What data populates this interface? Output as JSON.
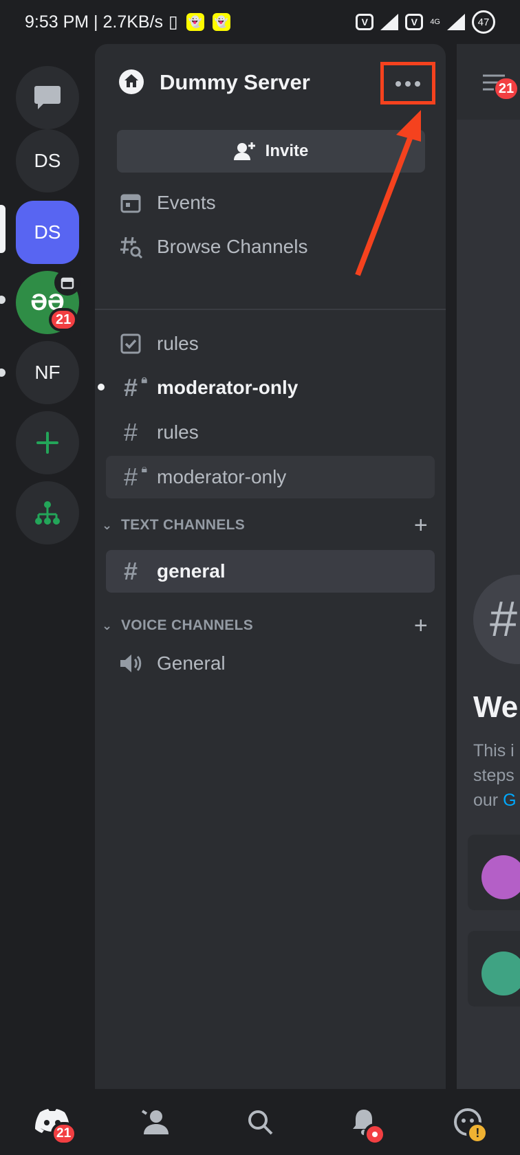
{
  "status_bar": {
    "time_speed": "9:53 PM | 2.7KB/s",
    "vibrate_glyph": "▯",
    "snap_glyph": "👻",
    "sim1": "V",
    "sim2": "V",
    "network": "4G",
    "battery": "47"
  },
  "guilds": [
    {
      "label": "DS"
    },
    {
      "label": "DS"
    },
    {
      "label": "ƏƏ",
      "badge": "21"
    },
    {
      "label": "NF"
    }
  ],
  "server": {
    "name": "Dummy Server",
    "invite_label": "Invite"
  },
  "menu_items": [
    {
      "label": "Events"
    },
    {
      "label": "Browse Channels"
    }
  ],
  "channels_top": [
    {
      "name": "rules"
    },
    {
      "name": "moderator-only"
    },
    {
      "name": "rules"
    },
    {
      "name": "moderator-only"
    }
  ],
  "text_category": {
    "label": "TEXT CHANNELS",
    "channels": [
      {
        "name": "general"
      }
    ]
  },
  "voice_category": {
    "label": "VOICE CHANNELS",
    "channels": [
      {
        "name": "General"
      }
    ]
  },
  "peek": {
    "badge": "21",
    "heading": "We",
    "line1": "This i",
    "line2": "steps",
    "line3_prefix": "our ",
    "line3_link": "G"
  },
  "bottom_nav": {
    "home_badge": "21",
    "warn_glyph": "!"
  },
  "colors": {
    "accent": "#5865f2",
    "highlight": "#f5421e",
    "badge": "#f23f42",
    "green": "#23a559"
  }
}
